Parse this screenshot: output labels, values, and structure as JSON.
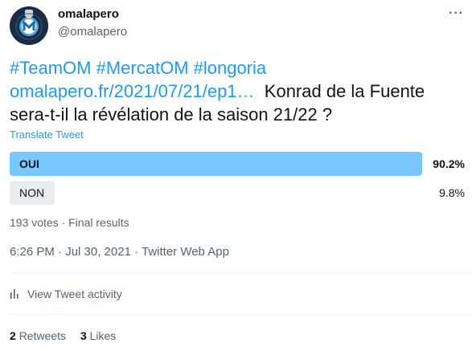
{
  "author": {
    "display_name": "omalapero",
    "handle": "@omalapero",
    "avatar_icon": "omalapero-logo-icon"
  },
  "more_options_icon": "more-dots-icon",
  "tweet": {
    "hashtags": [
      "#TeamOM",
      "#MercatOM",
      "#longoria"
    ],
    "link": "omalapero.fr/2021/07/21/ep1…",
    "text": "Konrad de la Fuente sera-t-il la révélation de la saison 21/22 ?",
    "translate_label": "Translate Tweet"
  },
  "poll": {
    "options": [
      {
        "label": "OUI",
        "percent": "90.2%",
        "share": 0.902,
        "winner": true
      },
      {
        "label": "NON",
        "percent": "9.8%",
        "share": 0.098,
        "winner": false
      }
    ],
    "summary": "193 votes · Final results"
  },
  "timestamp": "6:26 PM · Jul 30, 2021 · Twitter Web App",
  "activity": {
    "label": "View Tweet activity",
    "icon": "bar-chart-icon"
  },
  "stats": {
    "retweets_count": "2",
    "retweets_label": "Retweets",
    "likes_count": "3",
    "likes_label": "Likes"
  },
  "colors": {
    "link": "#1d9bf0",
    "poll_winner": "#78c8ff",
    "poll_other": "#e6ecf0",
    "secondary_text": "#536471"
  }
}
